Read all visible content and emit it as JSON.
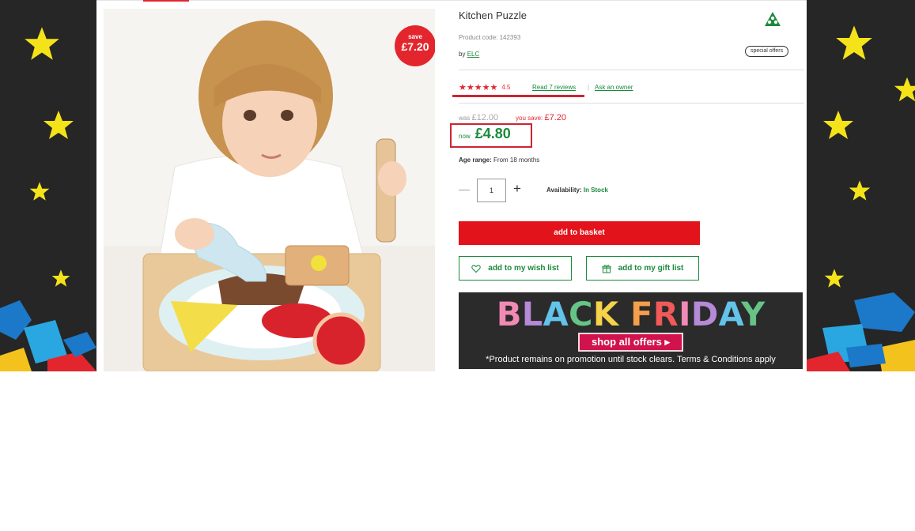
{
  "product": {
    "title": "Kitchen Puzzle",
    "product_code": "Product code: 142393",
    "by_prefix": "by",
    "brand": "ELC",
    "special_offers": "special offers",
    "save_badge": {
      "label": "save",
      "amount": "£7.20"
    },
    "image_icon": "kitchen-puzzle-photo"
  },
  "rating": {
    "stars_display": "★★★★★",
    "score": "4.5",
    "reviews_link": "Read 7 reviews",
    "separator": "|",
    "ask_link": "Ask an owner"
  },
  "price": {
    "was_label": "was",
    "was_amount": "£12.00",
    "save_label": "you save:",
    "save_amount": "£7.20",
    "now_label": "now",
    "now_amount": "£4.80"
  },
  "details": {
    "age_label": "Age range:",
    "age_value": "From 18 months",
    "quantity": "1",
    "minus": "—",
    "plus": "+",
    "availability_label": "Availability:",
    "availability_value": "In Stock"
  },
  "actions": {
    "add_to_basket": "add to basket",
    "wish_list": "add to my wish list",
    "gift_list": "add to my gift list"
  },
  "banner": {
    "title_letters": [
      "B",
      "L",
      "A",
      "C",
      "K",
      " ",
      "F",
      "R",
      "I",
      "D",
      "A",
      "Y"
    ],
    "title_colors": [
      "#f08bb6",
      "#b58ad6",
      "#63c3e8",
      "#67c486",
      "#f6d34a",
      " ",
      "#f59f4c",
      "#ef5a5a",
      "#f08bb6",
      "#b58ad6",
      "#63c3e8",
      "#67c486"
    ],
    "cta": "shop all offers ▸",
    "terms": "*Product remains on promotion until stock clears. Terms & Conditions apply"
  },
  "colors": {
    "accent_red": "#e3131b",
    "brand_green": "#1b8a3c",
    "background_dark": "#262626",
    "star_yellow": "#f5e31a"
  }
}
